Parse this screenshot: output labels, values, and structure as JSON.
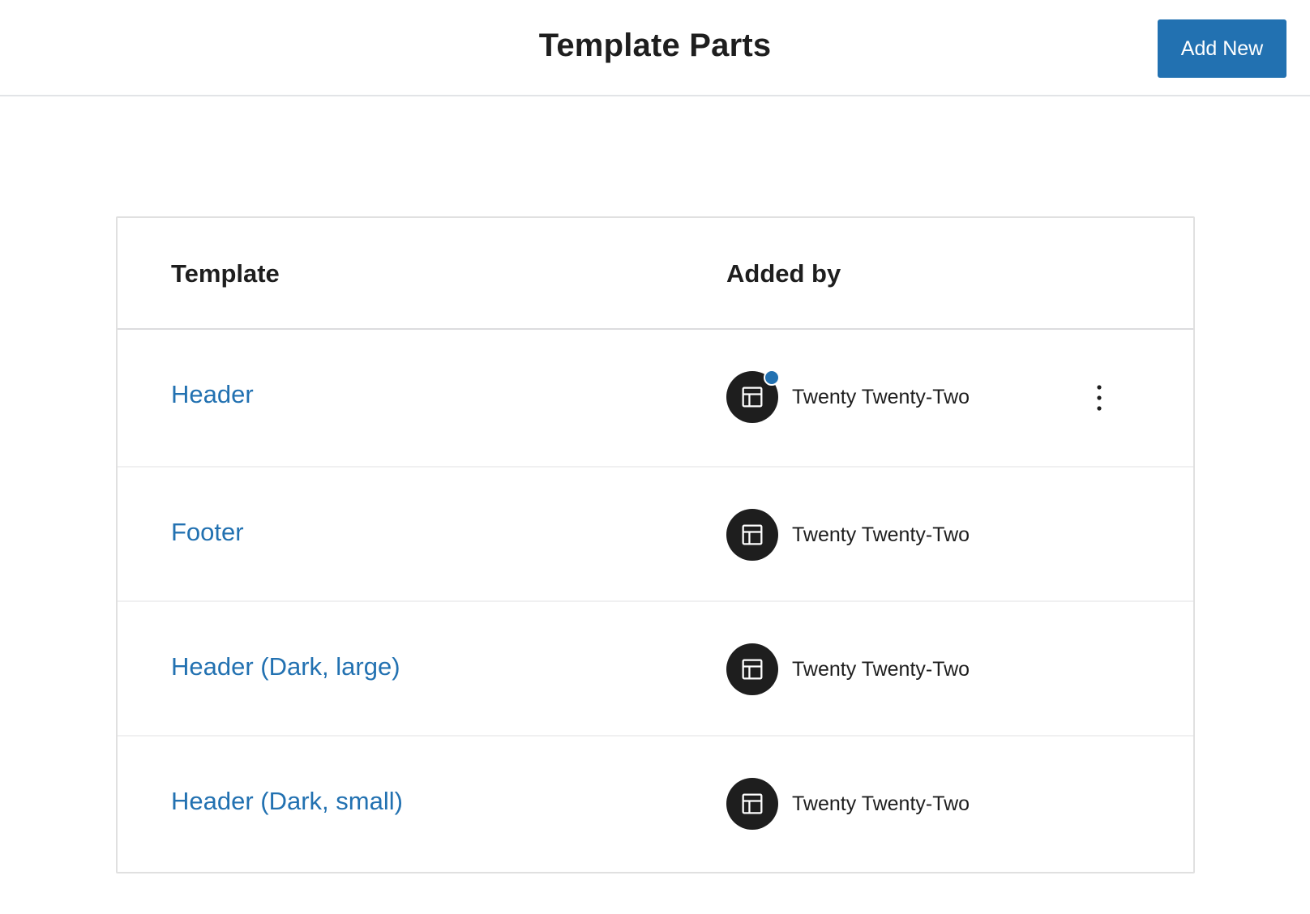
{
  "header": {
    "title": "Template Parts",
    "add_new_label": "Add New"
  },
  "table": {
    "columns": [
      "Template",
      "Added by"
    ],
    "rows": [
      {
        "title": "Header",
        "added_by": "Twenty Twenty-Two",
        "has_badge": true,
        "has_actions_menu": true
      },
      {
        "title": "Footer",
        "added_by": "Twenty Twenty-Two",
        "has_badge": false,
        "has_actions_menu": false
      },
      {
        "title": "Header (Dark, large)",
        "added_by": "Twenty Twenty-Two",
        "has_badge": false,
        "has_actions_menu": false
      },
      {
        "title": "Header (Dark, small)",
        "added_by": "Twenty Twenty-Two",
        "has_badge": false,
        "has_actions_menu": false
      }
    ]
  },
  "icons": {
    "author_avatar": "layout-icon",
    "row_actions": "more-vertical-icon"
  },
  "colors": {
    "accent": "#2271b1",
    "avatar_bg": "#1e1e1e",
    "text": "#1e1e1e"
  }
}
